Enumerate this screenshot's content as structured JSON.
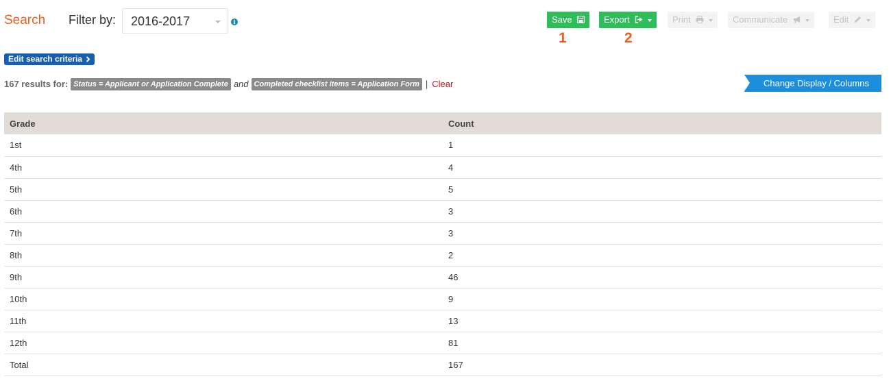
{
  "header": {
    "title": "Search",
    "filter_label": "Filter by:",
    "filter_value": "2016-2017"
  },
  "toolbar": {
    "save": "Save",
    "export": "Export",
    "print": "Print",
    "communicate": "Communicate",
    "edit": "Edit",
    "marker_1": "1",
    "marker_2": "2"
  },
  "criteria": {
    "edit_label": "Edit search criteria",
    "results_count": "167 results for:",
    "chip_1": "Status = Applicant or Application Complete",
    "and": "and",
    "chip_2": "Completed checklist items = Application Form",
    "separator": "|",
    "clear": "Clear"
  },
  "change_display": "Change Display / Columns",
  "table": {
    "columns": [
      "Grade",
      "Count"
    ],
    "rows": [
      [
        "1st",
        "1"
      ],
      [
        "4th",
        "4"
      ],
      [
        "5th",
        "5"
      ],
      [
        "6th",
        "3"
      ],
      [
        "7th",
        "3"
      ],
      [
        "8th",
        "2"
      ],
      [
        "9th",
        "46"
      ],
      [
        "10th",
        "9"
      ],
      [
        "11th",
        "13"
      ],
      [
        "12th",
        "81"
      ],
      [
        "Total",
        "167"
      ]
    ]
  },
  "icons": {
    "info": "info-icon",
    "save": "floppy-disk-icon",
    "export": "sign-out-icon",
    "print": "printer-icon",
    "communicate": "megaphone-icon",
    "edit": "pencil-icon",
    "chevron": "chevron-right-icon"
  },
  "colors": {
    "accent_orange": "#e8601c",
    "green_button": "#2ebd59",
    "blue_button": "#1760b0",
    "change_display_blue": "#1c8fdc",
    "clear_red": "#c9141f",
    "table_header": "#e1dcd7"
  }
}
